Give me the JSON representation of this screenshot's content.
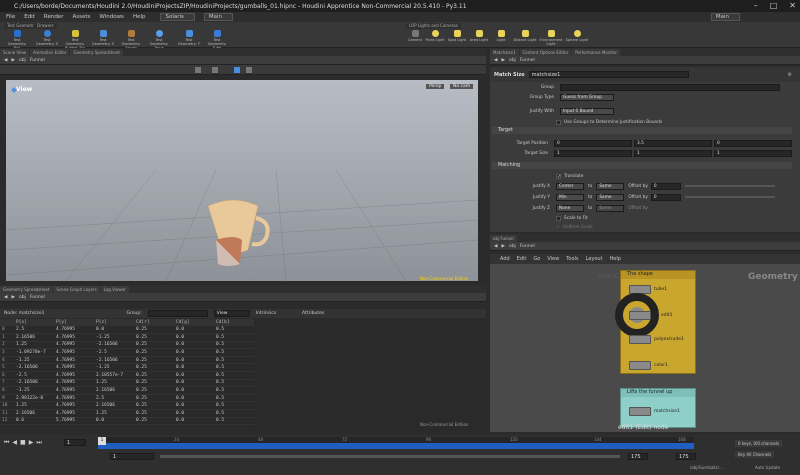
{
  "title": "C:/Users/borde/Documents/Houdini 2.0/HoudiniProjectsZIP/HoudiniProjects/gumballs_01.hipnc - Houdini Apprentice Non-Commercial 20.5.410 - Py3.11",
  "menu": [
    "File",
    "Edit",
    "Render",
    "Assets",
    "Windows",
    "Help"
  ],
  "desktop": "Solaris",
  "context_main": "Main",
  "context_main_right": "Main",
  "shelf_tabs_left": [
    "Test Geometry",
    "Drawers"
  ],
  "shelf_tabs_right": [
    "LOP Lights and Cameras"
  ],
  "tools_left": [
    "Test Geometry: Box",
    "Test Geometry: S",
    "Test Geometry: Rubber Toy",
    "Test Geometry: S",
    "Test Geometry: Squab",
    "Test Geometry: Torus",
    "Test Geometry: T",
    "Test Geometry: Tube"
  ],
  "tools_right": [
    "Camera",
    "Point Light",
    "Spot Light",
    "Area Light",
    "Light",
    "Distant Light",
    "Environment Light",
    "Sphere Light",
    "Sky Dome Light"
  ],
  "left_tabs": [
    "Scene View",
    "Animation Editor",
    "Geometry Spreadsheet"
  ],
  "right_top_tabs": [
    "Matchsize1",
    "Content Options Editor",
    "Performance Monitor"
  ],
  "path": {
    "context": "obj",
    "node": "Funnel"
  },
  "viewport": {
    "label": "View",
    "persp": "Persp",
    "cam": "No cam",
    "watermark": "Non-Commercial Edition"
  },
  "params": {
    "node_type": "Match Size",
    "node_name": "matchsize1",
    "group_label": "Group",
    "group_type_label": "Group Type",
    "group_type_value": "Guess from Group",
    "justify_with_label": "Justify With",
    "justify_with_value": "Input 0 Bound",
    "use_groups_label": "Use Groups to Determine Justification Bounds",
    "target_section": "Target",
    "target_position_label": "Target Position",
    "target_position": [
      "0",
      "3.5",
      "0"
    ],
    "target_size_label": "Target Size",
    "target_size": [
      "1",
      "1",
      "1"
    ],
    "matching_section": "Matching",
    "translate_label": "Translate",
    "justify_x_label": "Justify X",
    "justify_x": "Center",
    "justify_x_to": "Same",
    "justify_y_label": "Justify Y",
    "justify_y": "Min",
    "justify_y_to": "Same",
    "justify_z_label": "Justify Z",
    "justify_z": "None",
    "justify_z_to": "Same",
    "to_label": "to",
    "offset_by_label": "Offset by",
    "offset_x": "0",
    "offset_y": "0",
    "scale_to_fit": "Scale to Fit",
    "uniform_scale": "Uniform Scale"
  },
  "network": {
    "tabs": [
      "obj Funnel"
    ],
    "menu": [
      "Add",
      "Edit",
      "Go",
      "View",
      "Tools",
      "Layout",
      "Help"
    ],
    "geometry_label": "Geometry",
    "nonco_label": "Non-Co",
    "box1_title": "The shape",
    "nodes": [
      "tube1",
      "edit1",
      "polyextrude1",
      "color1"
    ],
    "box2_title": "Lifts the funnel up",
    "node2": "matchsize1",
    "hint": "edit1 (Edit) node"
  },
  "spreadsheet": {
    "tabs": [
      "Geometry Spreadsheet",
      "Scene Graph Layers",
      "Log Viewer"
    ],
    "node": "Node: matchsize1",
    "group_label": "Group:",
    "view_label": "View",
    "intrinsics": "Intrinsics",
    "attributes": "Attributes",
    "columns": [
      "",
      "P[x]",
      "P[y]",
      "P[z]",
      "Cd[r]",
      "Cd[g]",
      "Cd[b]"
    ],
    "rows": [
      [
        "0",
        "2.5",
        "4.76995",
        "0.0",
        "0.25",
        "0.0",
        "0.5"
      ],
      [
        "1",
        "2.16506",
        "4.76995",
        "-1.25",
        "0.25",
        "0.0",
        "0.5"
      ],
      [
        "2",
        "1.25",
        "4.76995",
        "-2.16506",
        "0.25",
        "0.0",
        "0.5"
      ],
      [
        "3",
        "-1.09278e-7",
        "4.76995",
        "-2.5",
        "0.25",
        "0.0",
        "0.5"
      ],
      [
        "4",
        "-1.25",
        "4.76995",
        "-2.16506",
        "0.25",
        "0.0",
        "0.5"
      ],
      [
        "5",
        "-2.16506",
        "4.76995",
        "-1.25",
        "0.25",
        "0.0",
        "0.5"
      ],
      [
        "6",
        "-2.5",
        "4.76995",
        "2.18557e-7",
        "0.25",
        "0.0",
        "0.5"
      ],
      [
        "7",
        "-2.16506",
        "4.76995",
        "1.25",
        "0.25",
        "0.0",
        "0.5"
      ],
      [
        "8",
        "-1.25",
        "4.76995",
        "2.16506",
        "0.25",
        "0.0",
        "0.5"
      ],
      [
        "9",
        "2.98122e-8",
        "4.76995",
        "2.5",
        "0.25",
        "0.0",
        "0.5"
      ],
      [
        "10",
        "1.25",
        "4.76995",
        "2.16506",
        "0.25",
        "0.0",
        "0.5"
      ],
      [
        "11",
        "2.16506",
        "4.76995",
        "1.25",
        "0.25",
        "0.0",
        "0.5"
      ],
      [
        "12",
        "0.6",
        "5.76995",
        "0.0",
        "0.25",
        "0.0",
        "0.5"
      ]
    ],
    "watermark": "Non-Commercial Edition"
  },
  "timeline": {
    "frame": "1",
    "start": "1",
    "end": "175",
    "end2": "175",
    "ticks": [
      "1",
      "24",
      "48",
      "72",
      "96",
      "120",
      "144",
      "168"
    ],
    "keys": "0 keys, 0/0 channels",
    "key_all": "Key All Channels",
    "path": "/obj/Gumballs/...",
    "auto_update": "Auto Update"
  },
  "colors": {
    "accent": "#2a6fd1",
    "netbox1": "#c9a62e",
    "netbox2": "#8fcfc9",
    "timeline": "#1f5fbf"
  }
}
